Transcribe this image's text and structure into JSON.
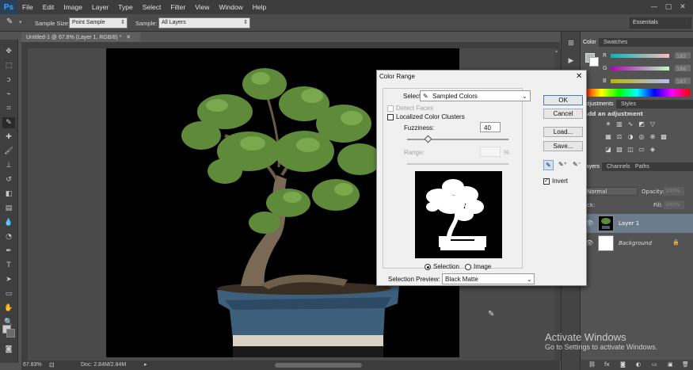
{
  "app": {
    "logo": "Ps"
  },
  "menu": [
    "File",
    "Edit",
    "Image",
    "Layer",
    "Type",
    "Select",
    "Filter",
    "View",
    "Window",
    "Help"
  ],
  "options_bar": {
    "sample_size_label": "Sample Size:",
    "sample_size_value": "Point Sample",
    "sample_label": "Sample:",
    "sample_value": "All Layers",
    "workspace": "Essentials"
  },
  "document": {
    "tab_title": "Untitled-1 @ 67.8% (Layer 1, RGB/8) *",
    "zoom": "67.83%",
    "doc_size": "Doc: 2.84M/2.84M"
  },
  "color_panel": {
    "tabs": [
      "Color",
      "Swatches"
    ],
    "channels": [
      {
        "label": "R",
        "value": "182"
      },
      {
        "label": "G",
        "value": "186"
      },
      {
        "label": "B",
        "value": "187"
      }
    ]
  },
  "adjustments_panel": {
    "tabs": [
      "Adjustments",
      "Styles"
    ],
    "hint": "Add an adjustment"
  },
  "layers_panel": {
    "tabs": [
      "Layers",
      "Channels",
      "Paths"
    ],
    "blend_mode": "Normal",
    "opacity_label": "Opacity:",
    "opacity_value": "100%",
    "fill_label": "Fill:",
    "fill_value": "100%",
    "lock_label": "Lock:",
    "layers": [
      {
        "name": "Layer 1",
        "selected": true
      },
      {
        "name": "Background",
        "selected": false
      }
    ]
  },
  "dialog": {
    "title": "Color Range",
    "select_label": "Select:",
    "select_value": "Sampled Colors",
    "detect_faces": "Detect Faces",
    "localized_clusters": "Localized Color Clusters",
    "fuzziness_label": "Fuzziness:",
    "fuzziness_value": "40",
    "range_label": "Range:",
    "range_unit": "%",
    "view_selection": "Selection",
    "view_image": "Image",
    "preview_label": "Selection Preview:",
    "preview_value": "Black Matte",
    "buttons": {
      "ok": "OK",
      "cancel": "Cancel",
      "load": "Load...",
      "save": "Save..."
    },
    "invert": "Invert"
  },
  "watermark": {
    "title": "Activate Windows",
    "subtitle": "Go to Settings to activate Windows."
  }
}
